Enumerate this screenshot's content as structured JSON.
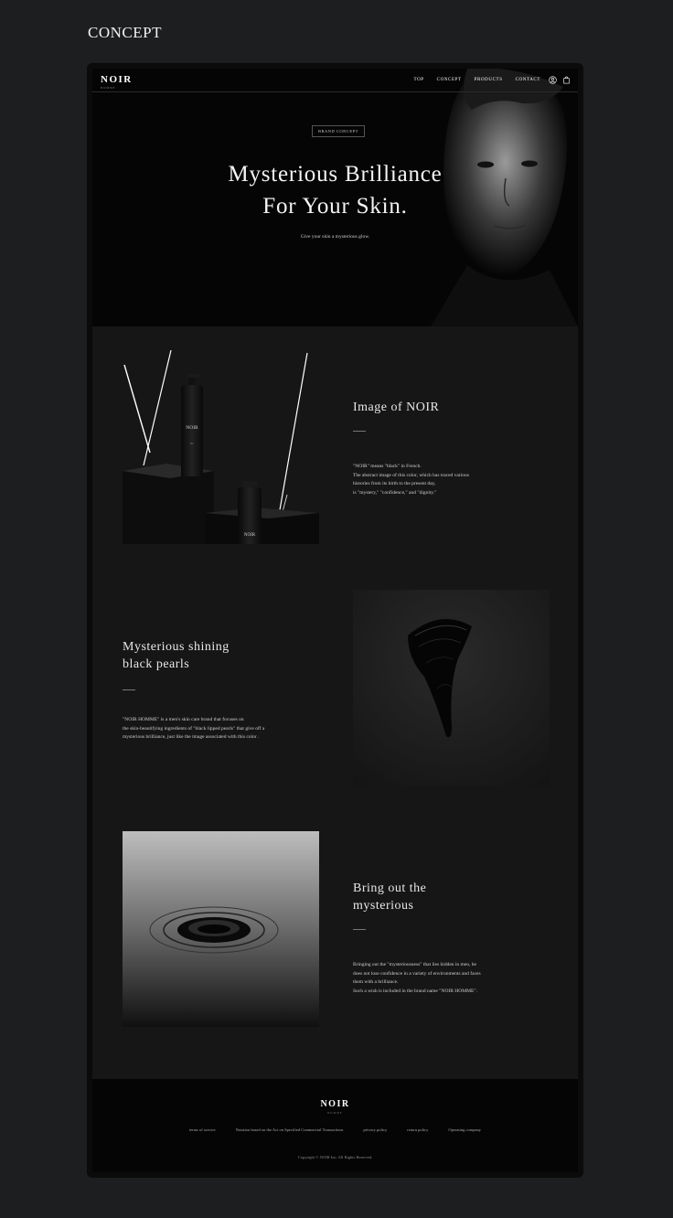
{
  "page": {
    "section_heading": "CONCEPT"
  },
  "nav": {
    "logo": "NOIR",
    "logo_sub": "HOMME",
    "links": [
      "TOP",
      "CONCEPT",
      "PRODUCTS",
      "CONTACT"
    ],
    "icons": [
      "user-icon",
      "shopping-bag-icon"
    ]
  },
  "hero": {
    "badge": "BRAND CONCEPT",
    "title_line1": "Mysterious Brilliance",
    "title_line2": "For Your Skin.",
    "subtitle": "Give your skin a mysterious glow."
  },
  "sections": [
    {
      "title_line1": "Image of NOIR",
      "title_line2": "",
      "body": [
        "\"NOIR\" means \"black\" in French.",
        "The abstract image of this color, which has traced various",
        "histories from its birth to the present day,",
        "is \"mystery,\" \"confidence,\" and \"dignity.\""
      ]
    },
    {
      "title_line1": "Mysterious shining",
      "title_line2": "black pearls",
      "body": [
        "\"NOIR HOMME\" is a men's skin care brand that focuses on",
        "the skin-beautifying ingredients of \"black lipped pearls\" that give off a",
        "mysterious brilliance, just like the image associated with this color ."
      ]
    },
    {
      "title_line1": "Bring out the",
      "title_line2": "mysterious",
      "body": [
        "Bringing out the \"mysteriousness\" that lies hidden in men, he",
        "does not lose confidence in a variety of environments and faces",
        "them with a brilliance.",
        "Such a wish is included in the brand name \"NOIR HOMME\"."
      ]
    }
  ],
  "products": {
    "bottle_label": "NOIR",
    "bottle_number": "01"
  },
  "footer": {
    "logo": "NOIR",
    "logo_sub": "HOMME",
    "links": [
      "terms of service",
      "Notation based on the Act on Specified Commercial Transactions",
      "privacy policy",
      "return policy",
      "Operating company"
    ],
    "copyright": "Copyright © NOIR Inc. All Rights Reserved."
  }
}
